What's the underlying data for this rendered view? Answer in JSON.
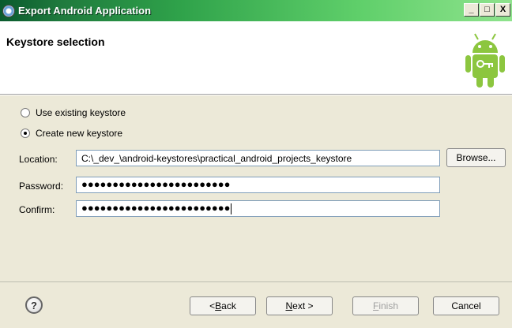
{
  "window": {
    "title": "Export Android Application",
    "controls": {
      "minimize": "_",
      "maximize": "□",
      "close": "X"
    }
  },
  "header": {
    "title": "Keystore selection",
    "icon": "android-robot-icon"
  },
  "keystore_options": {
    "use_existing": {
      "label": "Use existing keystore",
      "selected": false
    },
    "create_new": {
      "label": "Create new keystore",
      "selected": true
    }
  },
  "form": {
    "location": {
      "label": "Location:",
      "value": "C:\\_dev_\\android-keystores\\practical_android_projects_keystore"
    },
    "browse_button": "Browse...",
    "password": {
      "label": "Password:",
      "value": "●●●●●●●●●●●●●●●●●●●●●●●●"
    },
    "confirm": {
      "label": "Confirm:",
      "value": "●●●●●●●●●●●●●●●●●●●●●●●●"
    }
  },
  "footer": {
    "help_icon": "?",
    "back": {
      "prefix": "< ",
      "mnemonic": "B",
      "rest": "ack"
    },
    "next": {
      "mnemonic": "N",
      "rest": "ext >"
    },
    "finish": {
      "mnemonic": "F",
      "rest": "inish"
    },
    "cancel": "Cancel"
  }
}
